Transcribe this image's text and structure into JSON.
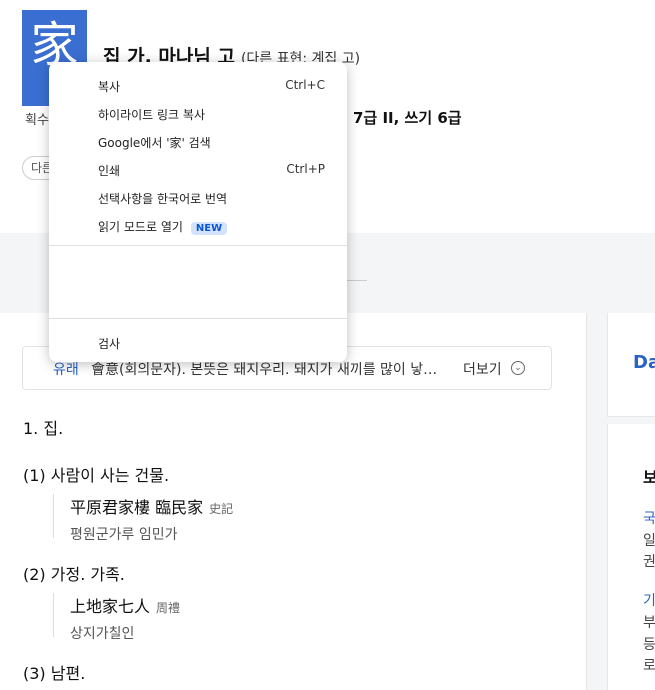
{
  "entry": {
    "hanja": "家",
    "title": "집 가, 마나님 고",
    "alt_form": "(다른 표현: 계집 고)",
    "meta_left": "획수",
    "grade": "7급 II, 쓰기 6급",
    "chip": "다른"
  },
  "origin": {
    "label": "유래",
    "text": "會意(회의문자). 본뜻은 돼지우리. 돼지가 새끼를 많이 낳…",
    "more": "더보기"
  },
  "definitions": {
    "d1": "1.   집.",
    "d1_1": "(1)  사람이 사는 건물.",
    "ex1_hanja": "平原君家樓 臨民家",
    "ex1_src": "史記",
    "ex1_read": "평원군가루 임민가",
    "d1_2": "(2)  가정. 가족.",
    "ex2_hanja": "上地家七人",
    "ex2_src": "周禮",
    "ex2_read": "상지가칠인",
    "d1_3": "(3)  남편."
  },
  "right": {
    "da": "Da",
    "r1": "보",
    "r2": "국",
    "r3": "일",
    "r4": "권",
    "r5": "기",
    "r6": "부",
    "r7": "등",
    "r8": "로"
  },
  "context_menu": {
    "copy": "복사",
    "copy_shortcut": "Ctrl+C",
    "copy_highlight_link": "하이라이트 링크 복사",
    "google_search": "Google에서 '家' 검색",
    "print": "인쇄",
    "print_shortcut": "Ctrl+P",
    "translate": "선택사항을 한국어로 번역",
    "reading_mode": "읽기 모드로 열기",
    "new_badge": "NEW",
    "inspect": "검사"
  }
}
